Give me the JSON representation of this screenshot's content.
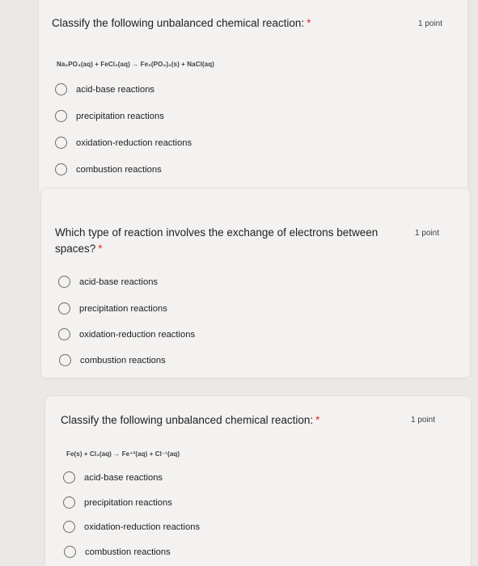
{
  "questions": [
    {
      "title": "Classify the following unbalanced chemical reaction:",
      "required_mark": "*",
      "points": "1 point",
      "equation": "Na₃PO₄(aq) + FeCl₂(aq) → Fe₃(PO₄)₂(s) + NaCl(aq)",
      "options": [
        "acid-base reactions",
        "precipitation reactions",
        "oxidation-reduction reactions",
        "combustion reactions"
      ]
    },
    {
      "title_line1": "Which type of reaction involves the exchange of electrons between",
      "title_line2": "spaces?",
      "required_mark": "*",
      "points": "1 point",
      "options": [
        "acid-base reactions",
        "precipitation reactions",
        "oxidation-reduction reactions",
        "combustion reactions"
      ]
    },
    {
      "title": "Classify the following unbalanced chemical reaction:",
      "required_mark": "*",
      "points": "1 point",
      "equation": "Fe(s) + Cl₂(aq) → Fe⁺²(aq) + Cl⁻¹(aq)",
      "options": [
        "acid-base reactions",
        "precipitation reactions",
        "oxidation-reduction reactions",
        "combustion reactions"
      ]
    }
  ]
}
